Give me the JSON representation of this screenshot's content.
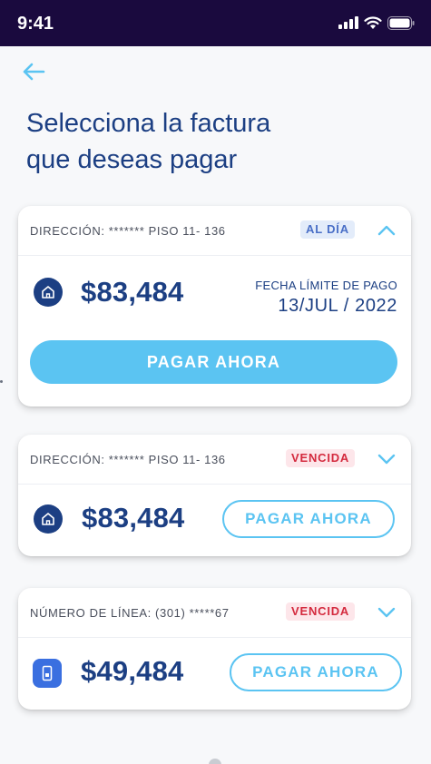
{
  "status_bar": {
    "time": "9:41",
    "icons": [
      "signal-icon",
      "wifi-icon",
      "battery-icon"
    ]
  },
  "page": {
    "title_line1": "Selecciona la factura",
    "title_line2": "que deseas pagar"
  },
  "colors": {
    "status_bar_bg": "#1a0a3e",
    "primary_dark": "#1c3f83",
    "accent": "#5bc4f2",
    "badge_ok": "#4a6fc7",
    "badge_due": "#d42a3e"
  },
  "invoices": [
    {
      "label": "DIRECCIÓN: ******* PISO 11- 136",
      "status": "AL DÍA",
      "expanded": true,
      "icon": "home-icon",
      "amount": "$83,484",
      "due_label": "FECHA LÍMITE DE PAGO",
      "due_date": "13/JUL / 2022",
      "button": "PAGAR AHORA"
    },
    {
      "label": "DIRECCIÓN: ******* PISO 11- 136",
      "status": "VENCIDA",
      "expanded": false,
      "icon": "home-icon",
      "amount": "$83,484",
      "button": "PAGAR AHORA"
    },
    {
      "label": "NÚMERO DE LÍNEA: (301) *****67",
      "status": "VENCIDA",
      "expanded": false,
      "icon": "phone-icon",
      "amount": "$49,484",
      "button": "PAGAR AHORA"
    }
  ]
}
